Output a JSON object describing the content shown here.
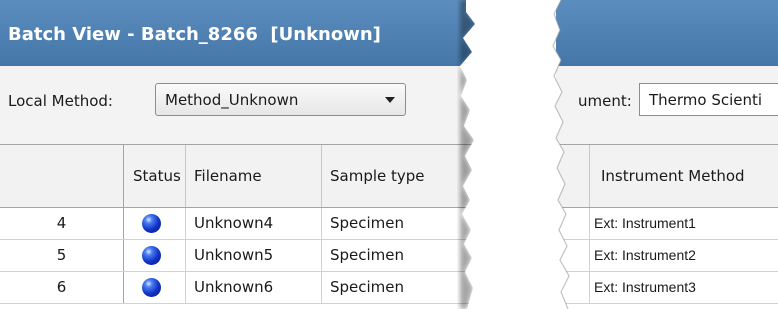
{
  "window": {
    "title": "Batch View - Batch_8266  [Unknown]"
  },
  "method_bar": {
    "local_method_label": "Local Method:",
    "local_method_value": "Method_Unknown",
    "instrument_label": "ument:",
    "instrument_value": "Thermo Scienti"
  },
  "table": {
    "columns": [
      "Status",
      "Filename",
      "Sample type",
      "Instrument Method"
    ],
    "rows": [
      {
        "number": "4",
        "status": "blue-ball-icon",
        "filename": "Unknown4",
        "sample_type": "Specimen",
        "instrument_method": "Ext: Instrument1"
      },
      {
        "number": "5",
        "status": "blue-ball-icon",
        "filename": "Unknown5",
        "sample_type": "Specimen",
        "instrument_method": "Ext: Instrument2"
      },
      {
        "number": "6",
        "status": "blue-ball-icon",
        "filename": "Unknown6",
        "sample_type": "Specimen",
        "instrument_method": "Ext: Instrument3"
      }
    ]
  },
  "colors": {
    "title_bar": "#4a7db0",
    "status_ball": "#1232c8"
  }
}
